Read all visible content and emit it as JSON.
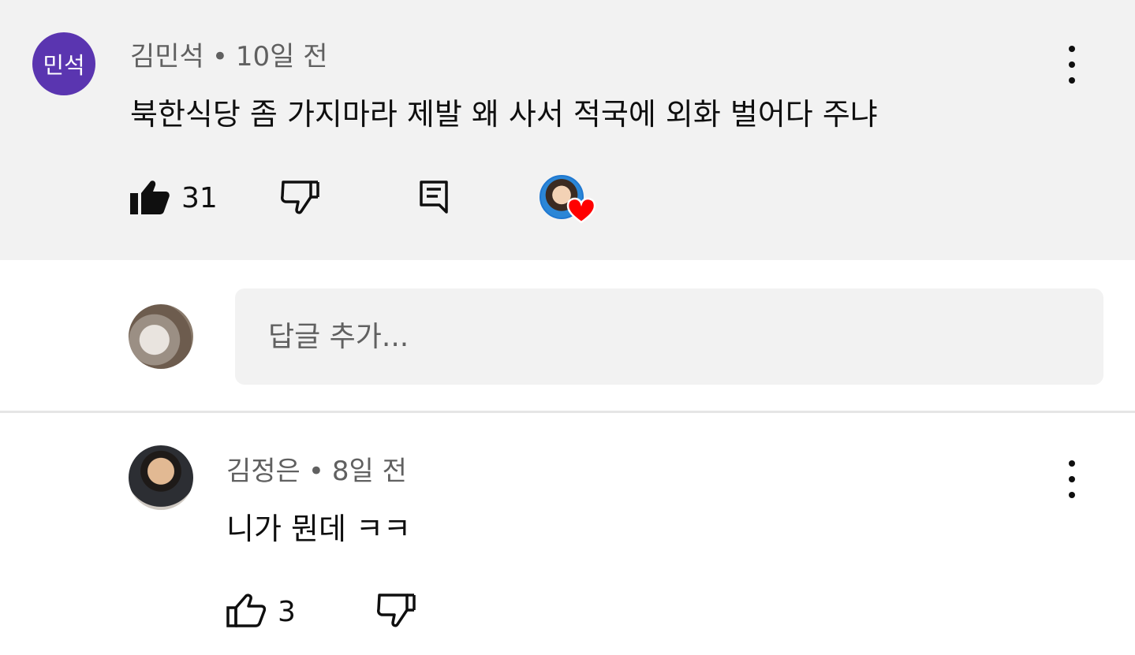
{
  "comment": {
    "avatar_initials": "민석",
    "author": "김민석",
    "separator": "•",
    "time": "10일 전",
    "text": "북한식당 좀 가지마라 제발 왜 사서 적국에 외화 벌어다 주냐",
    "like_count": "31",
    "liked": true,
    "creator_heart": true,
    "colors": {
      "avatar_bg": "#5a35b0",
      "heart": "#ff0000",
      "background": "#f2f2f2"
    }
  },
  "reply_box": {
    "placeholder": "답글 추가..."
  },
  "reply": {
    "author": "김정은",
    "separator": "•",
    "time": "8일 전",
    "text": "니가 뭔데 ㅋㅋ",
    "like_count": "3",
    "liked": false
  }
}
